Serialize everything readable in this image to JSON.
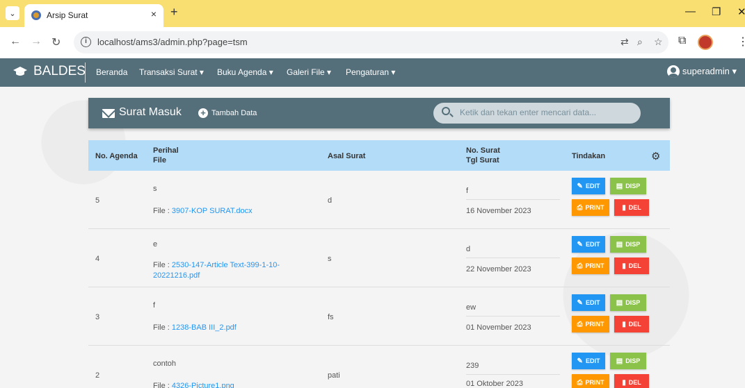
{
  "browser": {
    "tab_title": "Arsip Surat",
    "tab_close": "×",
    "new_tab": "+",
    "url": "localhost/ams3/admin.php?page=tsm"
  },
  "navbar": {
    "brand": "BALDES",
    "items": [
      "Beranda",
      "Transaksi Surat ▾",
      "Buku Agenda ▾",
      "Galeri File ▾",
      "Pengaturan ▾"
    ],
    "user": "superadmin ▾"
  },
  "header": {
    "title": "Surat Masuk",
    "add_label": "Tambah Data",
    "search_placeholder": "Ketik dan tekan enter mencari data..."
  },
  "table": {
    "col_no_agenda": "No. Agenda",
    "col_perihal": "Perihal",
    "col_file": "File",
    "col_asal": "Asal Surat",
    "col_no_surat": "No. Surat",
    "col_tgl": "Tgl Surat",
    "col_tindakan": "Tindakan",
    "file_prefix": "File : ",
    "btn_edit": "EDIT",
    "btn_disp": "DISP",
    "btn_print": "PRINT",
    "btn_del": "DEL",
    "rows": [
      {
        "no": "5",
        "perihal": "s",
        "file1": "3907-KOP SURAT.docx",
        "file2": "",
        "asal": "d",
        "no_surat": "f",
        "tgl": "16 November 2023"
      },
      {
        "no": "4",
        "perihal": "e",
        "file1": "2530-147-Article Text-399-1-10-",
        "file2": "20221216.pdf",
        "asal": "s",
        "no_surat": "d",
        "tgl": "22 November 2023"
      },
      {
        "no": "3",
        "perihal": "f",
        "file1": "1238-BAB III_2.pdf",
        "file2": "",
        "asal": "fs",
        "no_surat": "ew",
        "tgl": "01 November 2023"
      },
      {
        "no": "2",
        "perihal": "contoh",
        "file1": "4326-Picture1.png",
        "file2": "",
        "asal": "pati",
        "no_surat": "239",
        "tgl": "01 Oktober 2023"
      }
    ]
  },
  "colors": {
    "navbar": "#546e7a",
    "table_header": "#b3dcf8",
    "edit": "#2196f3",
    "disp": "#8bc34a",
    "print": "#ff9800",
    "del": "#f44336",
    "tab_strip": "#f9df72"
  }
}
